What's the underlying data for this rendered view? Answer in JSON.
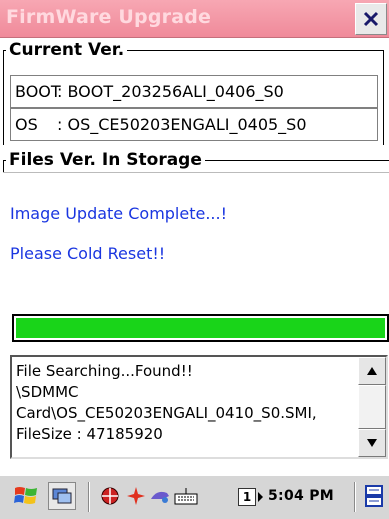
{
  "window": {
    "title": "FirmWare Upgrade"
  },
  "current_version": {
    "group_label": "Current Ver.",
    "boot_label": "BOOT",
    "boot_value": ": BOOT_203256ALI_0406_S0",
    "os_label": "OS",
    "os_value": ": OS_CE50203ENGALI_0405_S0"
  },
  "storage": {
    "group_label": "Files Ver. In Storage",
    "message_1": "Image Update Complete...!",
    "message_2": "Please Cold Reset!!"
  },
  "progress": {
    "percent": 100,
    "color": "#19d419"
  },
  "log": {
    "text": "File Searching...Found!!\n\\SDMMC Card\\OS_CE50203ENGALI_0410_S0.SMI, FileSize : 47185920"
  },
  "taskbar": {
    "input_number": "1",
    "clock": "5:04 PM"
  },
  "colors": {
    "title_bar": "#f08a9a",
    "message_text": "#1a36e0",
    "progress_fill": "#19d419"
  }
}
